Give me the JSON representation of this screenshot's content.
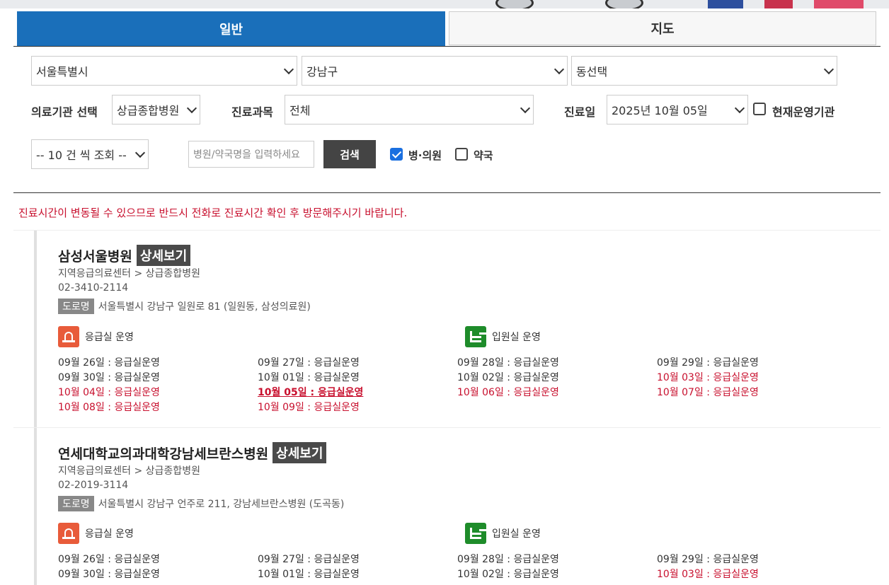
{
  "tabs": {
    "general": "일반",
    "map": "지도"
  },
  "filters": {
    "city": "서울특별시",
    "district": "강남구",
    "dong": "동선택",
    "institution_label": "의료기관 선택",
    "institution_value": "상급종합병원",
    "department_label": "진료과목",
    "department_value": "전체",
    "date_label": "진료일",
    "date_value": "2025년 10월 05일",
    "currently_open_label": "현재운영기관",
    "page_size": "-- 10 건 씩 조회 --",
    "search_placeholder": "병원/약국명을 입력하세요",
    "search_button": "검색",
    "hospital_label": "병·의원",
    "hospital_checked": true,
    "pharmacy_label": "약국",
    "pharmacy_checked": false
  },
  "notice": "진료시간이 변동될 수 있으므로 반드시 전화로 진료시간 확인 후 방문해주시기 바랍니다.",
  "hospitals": [
    {
      "name": "삼성서울병원",
      "detail_button": "상세보기",
      "category": "지역응급의료센터 > 상급종합병원",
      "phone": "02-3410-2114",
      "addr_badge": "도로명",
      "address": "서울특별시 강남구 일원로 81 (일원동, 삼성의료원)",
      "er_label": "응급실 운영",
      "ward_label": "입원실 운영",
      "schedule": [
        "09월 26일 : 응급실운영",
        "09월 27일 : 응급실운영",
        "09월 28일 : 응급실운영",
        "09월 29일 : 응급실운영",
        "09월 30일 : 응급실운영",
        "10월 01일 : 응급실운영",
        "10월 02일 : 응급실운영",
        "10월 03일 : 응급실운영",
        "10월 04일 : 응급실운영",
        "10월 05일 : 응급실운영",
        "10월 06일 : 응급실운영",
        "10월 07일 : 응급실운영",
        "10월 08일 : 응급실운영",
        "10월 09일 : 응급실운영"
      ]
    },
    {
      "name": "연세대학교의과대학강남세브란스병원",
      "detail_button": "상세보기",
      "category": "지역응급의료센터 > 상급종합병원",
      "phone": "02-2019-3114",
      "addr_badge": "도로명",
      "address": "서울특별시 강남구 언주로 211, 강남세브란스병원 (도곡동)",
      "er_label": "응급실 운영",
      "ward_label": "입원실 운영",
      "schedule": [
        "09월 26일 : 응급실운영",
        "09월 27일 : 응급실운영",
        "09월 28일 : 응급실운영",
        "09월 29일 : 응급실운영",
        "09월 30일 : 응급실운영",
        "10월 01일 : 응급실운영",
        "10월 02일 : 응급실운영",
        "10월 03일 : 응급실운영"
      ]
    }
  ],
  "colors": {
    "tab_active": "#1a6fba",
    "notice": "#c8102e",
    "holiday": "#c8102e",
    "er_icon": "#e85b3a",
    "ward_icon": "#1e8c2a"
  }
}
